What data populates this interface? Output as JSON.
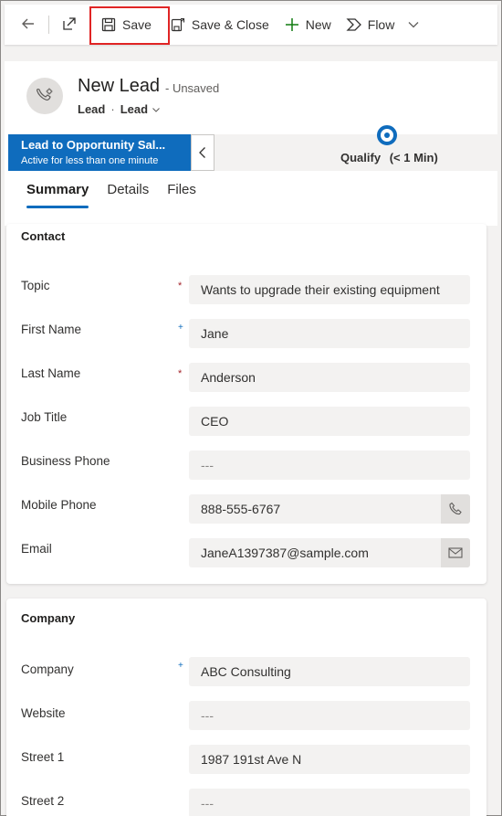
{
  "toolbar": {
    "back_icon": "back-arrow-icon",
    "popout_icon": "open-in-new-window-icon",
    "save_label": "Save",
    "save_close_label": "Save & Close",
    "new_label": "New",
    "flow_label": "Flow",
    "highlight_color": "#e02424"
  },
  "header": {
    "title": "New Lead",
    "unsaved": "- Unsaved",
    "entity": "Lead",
    "form_selector": "Lead"
  },
  "bpf": {
    "process_name": "Lead to Opportunity Sal...",
    "process_status": "Active for less than one minute",
    "stage_label": "Qualify",
    "stage_duration": "(< 1 Min)",
    "accent": "#0f6cbd"
  },
  "tabs": [
    {
      "label": "Summary",
      "active": true
    },
    {
      "label": "Details",
      "active": false
    },
    {
      "label": "Files",
      "active": false
    }
  ],
  "contact": {
    "title": "Contact",
    "fields": {
      "topic": {
        "label": "Topic",
        "value": "Wants to upgrade their existing equipment",
        "requirement": "*"
      },
      "first_name": {
        "label": "First Name",
        "value": "Jane",
        "requirement": "+"
      },
      "last_name": {
        "label": "Last Name",
        "value": "Anderson",
        "requirement": "*"
      },
      "job_title": {
        "label": "Job Title",
        "value": "CEO"
      },
      "business_phone": {
        "label": "Business Phone",
        "value": "---"
      },
      "mobile_phone": {
        "label": "Mobile Phone",
        "value": "888-555-6767"
      },
      "email": {
        "label": "Email",
        "value": "JaneA1397387@sample.com"
      }
    }
  },
  "company": {
    "title": "Company",
    "fields": {
      "company": {
        "label": "Company",
        "value": "ABC Consulting",
        "requirement": "+"
      },
      "website": {
        "label": "Website",
        "value": "---"
      },
      "street1": {
        "label": "Street 1",
        "value": "1987 191st Ave N"
      },
      "street2": {
        "label": "Street 2",
        "value": "---"
      }
    }
  }
}
